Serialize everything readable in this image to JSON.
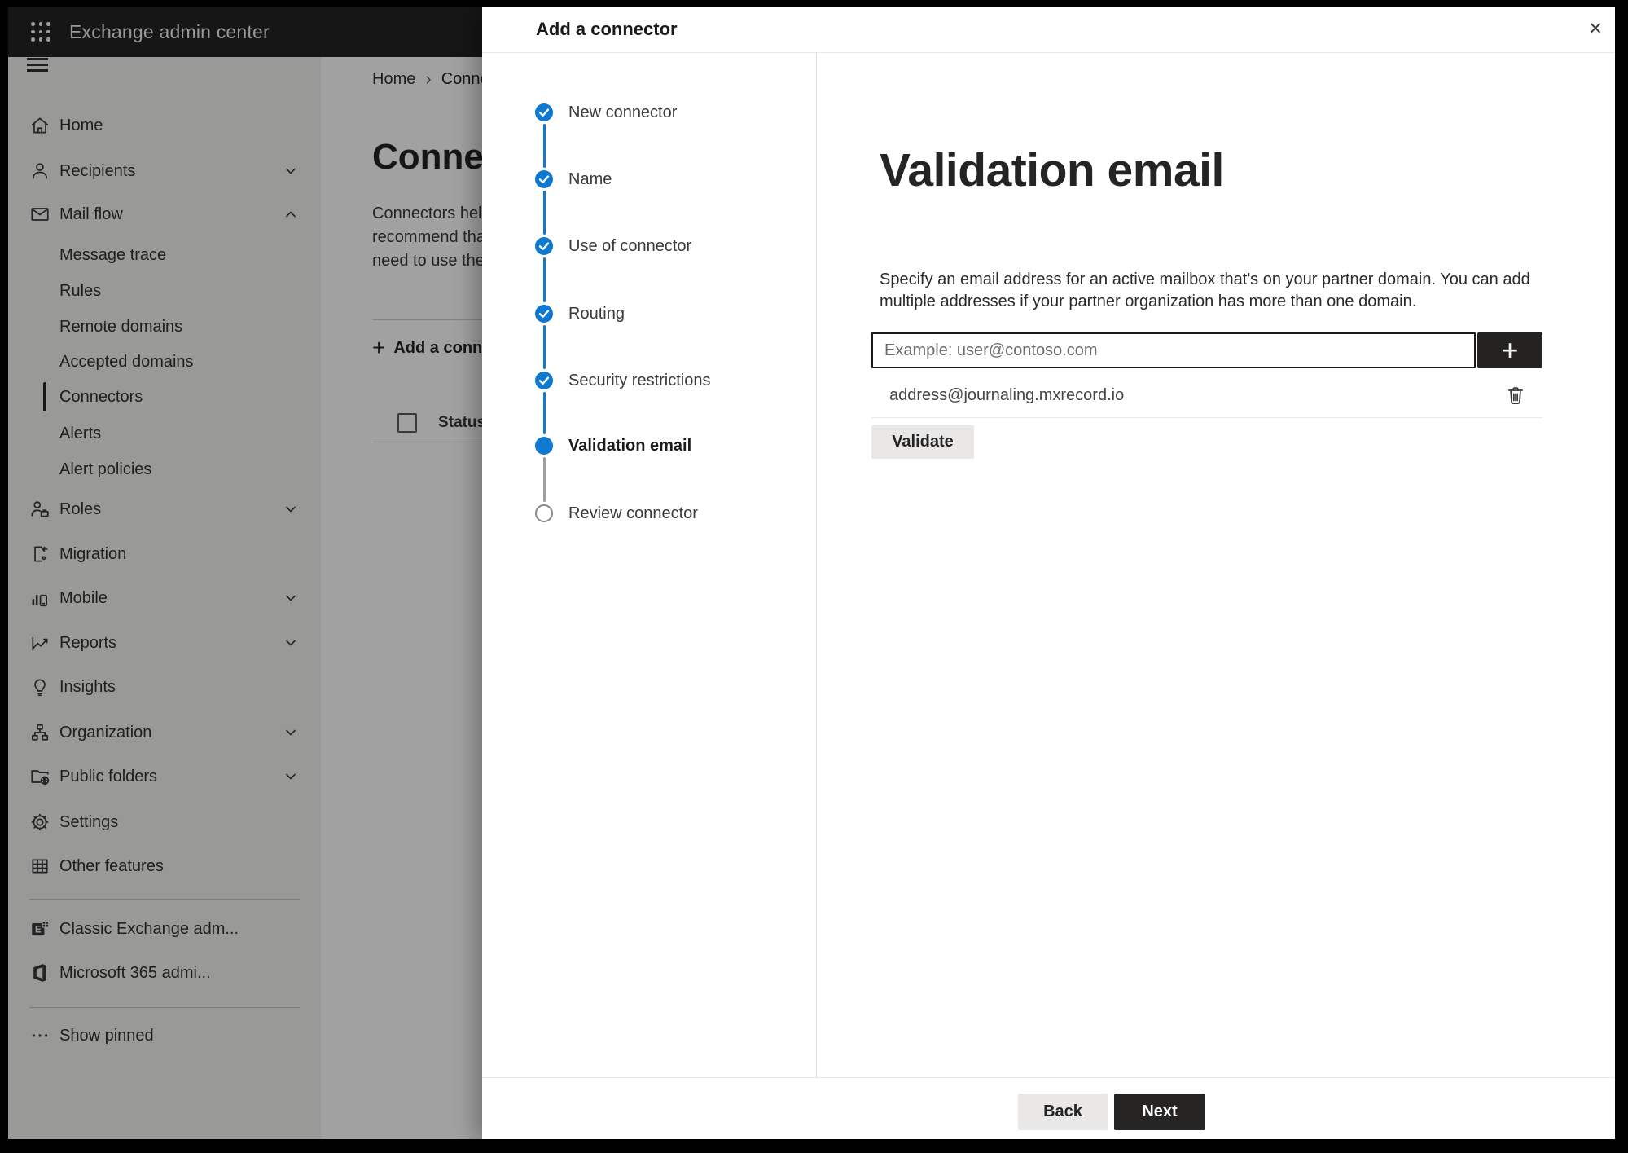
{
  "header": {
    "title": "Exchange admin center"
  },
  "sidebar": {
    "items": [
      {
        "label": "Home",
        "icon": "home"
      },
      {
        "label": "Recipients",
        "icon": "person",
        "chevron": "down"
      },
      {
        "label": "Mail flow",
        "icon": "mail",
        "chevron": "up",
        "expanded": true
      },
      {
        "label": "Message trace",
        "sub": true
      },
      {
        "label": "Rules",
        "sub": true
      },
      {
        "label": "Remote domains",
        "sub": true
      },
      {
        "label": "Accepted domains",
        "sub": true
      },
      {
        "label": "Connectors",
        "sub": true,
        "selected": true
      },
      {
        "label": "Alerts",
        "sub": true
      },
      {
        "label": "Alert policies",
        "sub": true
      },
      {
        "label": "Roles",
        "icon": "roles",
        "chevron": "down"
      },
      {
        "label": "Migration",
        "icon": "migration"
      },
      {
        "label": "Mobile",
        "icon": "mobile",
        "chevron": "down"
      },
      {
        "label": "Reports",
        "icon": "reports",
        "chevron": "down"
      },
      {
        "label": "Insights",
        "icon": "insights"
      },
      {
        "label": "Organization",
        "icon": "organization",
        "chevron": "down"
      },
      {
        "label": "Public folders",
        "icon": "public-folders",
        "chevron": "down"
      },
      {
        "label": "Settings",
        "icon": "settings"
      },
      {
        "label": "Other features",
        "icon": "other-features"
      },
      {
        "label": "Classic Exchange adm...",
        "icon": "classic-exchange"
      },
      {
        "label": "Microsoft 365 admi...",
        "icon": "microsoft-365"
      },
      {
        "label": "Show pinned",
        "icon": "more"
      }
    ]
  },
  "page": {
    "breadcrumb": {
      "home": "Home",
      "separator": "›",
      "current": "Conne"
    },
    "title": "Connect",
    "description_lines": [
      "Connectors help",
      "recommend that",
      "need to use ther"
    ],
    "add_button_plus": "+",
    "add_button_label": "Add a conn",
    "status_header": "Status"
  },
  "panel": {
    "title": "Add a connector",
    "close_icon": "✕",
    "steps": [
      {
        "label": "New connector",
        "state": "completed"
      },
      {
        "label": "Name",
        "state": "completed"
      },
      {
        "label": "Use of connector",
        "state": "completed"
      },
      {
        "label": "Routing",
        "state": "completed"
      },
      {
        "label": "Security restrictions",
        "state": "completed"
      },
      {
        "label": "Validation email",
        "state": "current"
      },
      {
        "label": "Review connector",
        "state": "upcoming"
      }
    ],
    "content": {
      "heading": "Validation email",
      "description_line1": "Specify an email address for an active mailbox that's on your partner domain. You can add",
      "description_line2": "multiple addresses if your partner organization has more than one domain.",
      "email_input_placeholder": "Example: user@contoso.com",
      "email_input_value": "",
      "add_address_button": "+",
      "addresses": [
        {
          "email": "address@journaling.mxrecord.io"
        }
      ],
      "validate_button": "Validate"
    },
    "footer": {
      "back_button": "Back",
      "next_button": "Next"
    }
  },
  "colors": {
    "accent_blue": "#0f78d0",
    "header_bg": "#252423",
    "sidebar_bg": "#f3f2f1",
    "dark_button_bg": "#242322",
    "neutral_button_bg": "#e9e8e7",
    "dim_overlay": "rgba(0,0,0,0.37)"
  }
}
